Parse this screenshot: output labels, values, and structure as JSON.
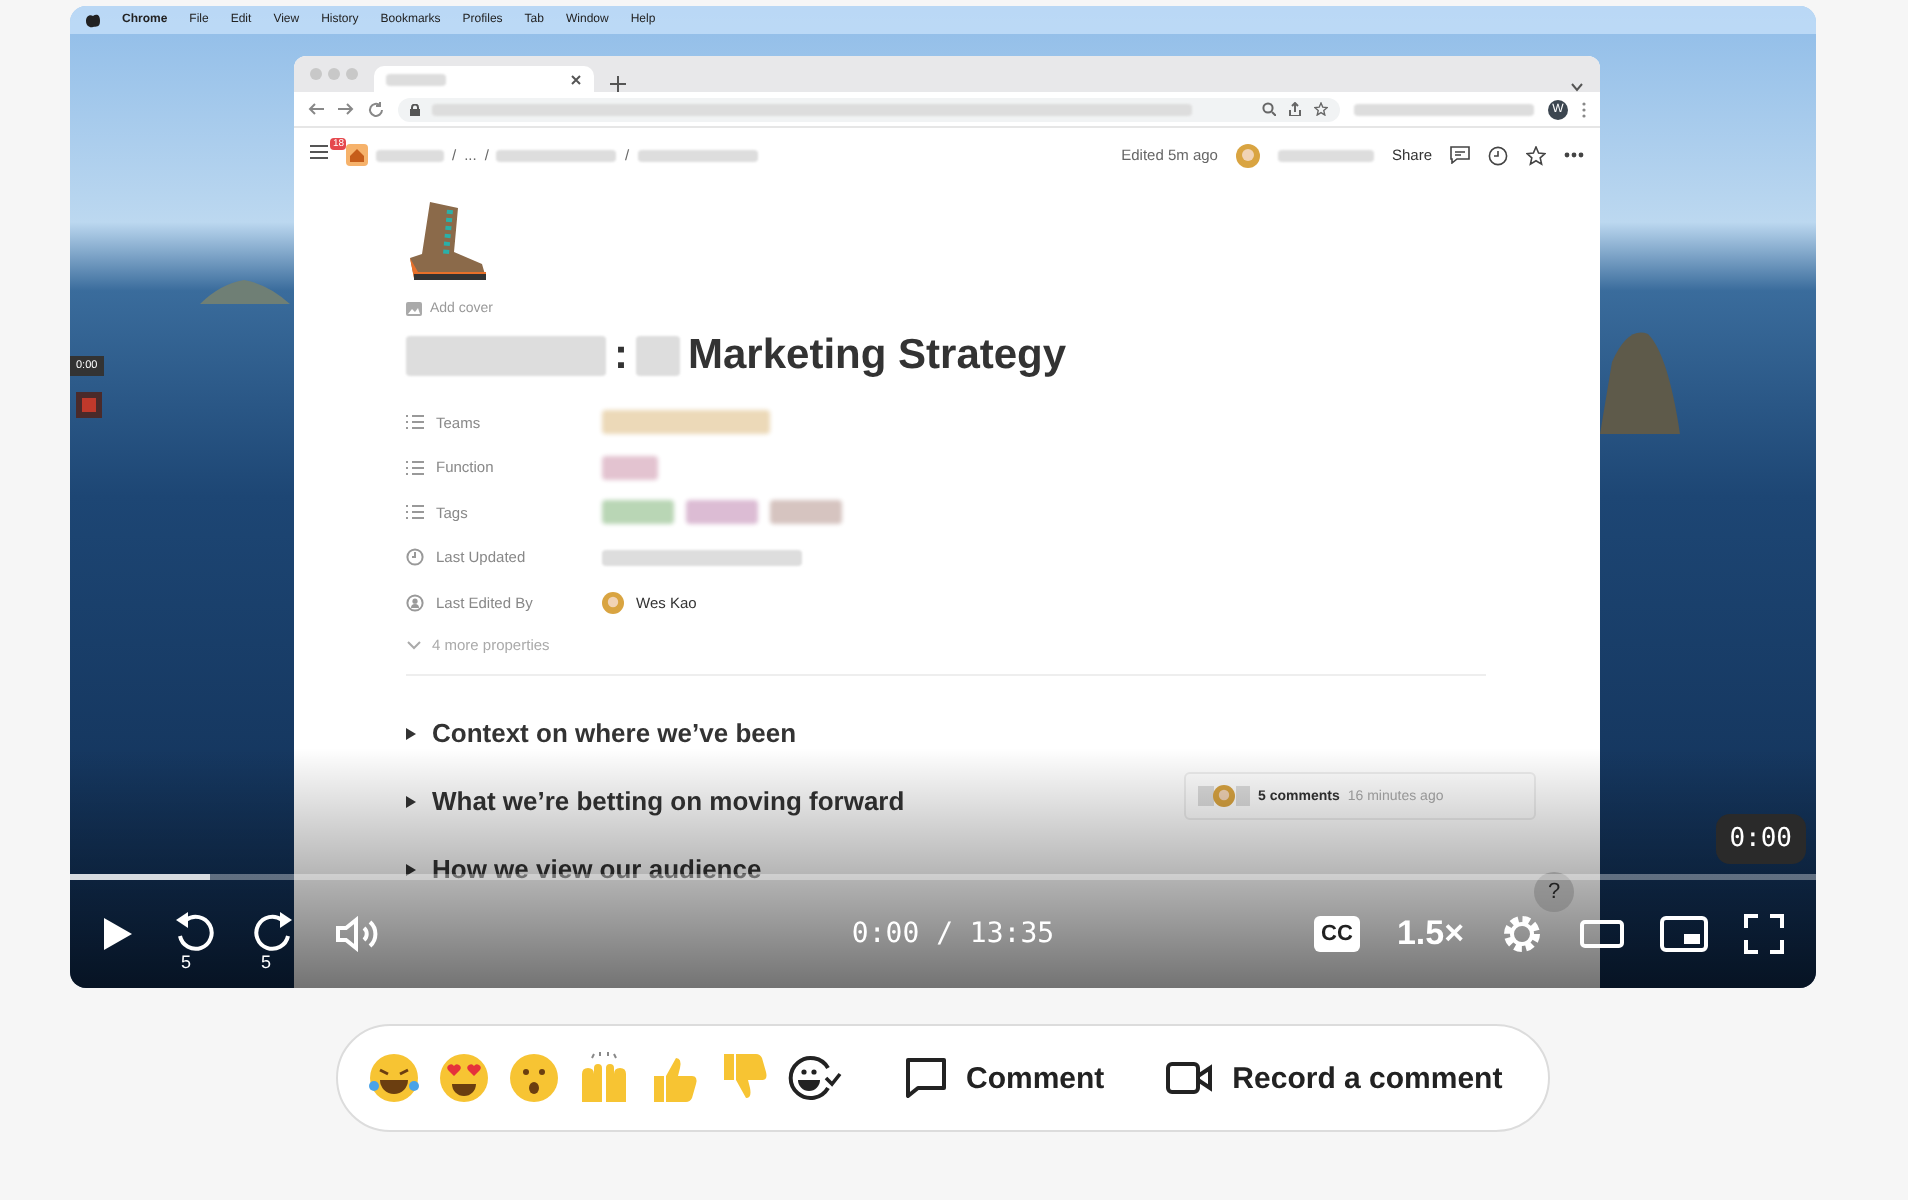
{
  "video": {
    "menu_bar": [
      "Chrome",
      "File",
      "Edit",
      "View",
      "History",
      "Bookmarks",
      "Profiles",
      "Tab",
      "Window",
      "Help"
    ],
    "side_badge": "0:00",
    "browser": {
      "profile_initial": "W"
    },
    "notion_header": {
      "notification_count": "18",
      "breadcrumb": [
        {
          "kind": "hidden"
        },
        {
          "kind": "text",
          "text": "/"
        },
        {
          "kind": "text",
          "text": "..."
        },
        {
          "kind": "text",
          "text": "/"
        },
        {
          "kind": "hidden"
        },
        {
          "kind": "text",
          "text": "/"
        },
        {
          "kind": "hidden"
        }
      ],
      "edited": "Edited 5m ago",
      "share": "Share"
    },
    "page": {
      "add_cover": "Add cover",
      "title": [
        {
          "kind": "hidden"
        },
        {
          "kind": "text",
          "text": ":"
        },
        {
          "kind": "hidden"
        },
        {
          "kind": "text",
          "text": "Marketing Strategy"
        }
      ],
      "properties": [
        {
          "kind": "tags",
          "label": "Teams",
          "tags": [
            {
              "color": "#ecd9b8"
            }
          ]
        },
        {
          "kind": "tags",
          "label": "Function",
          "tags": [
            {
              "color": "#e3c3d0"
            }
          ]
        },
        {
          "kind": "tags",
          "label": "Tags",
          "tags": [
            {
              "color": "#b9d6b5"
            },
            {
              "color": "#dcbcd4"
            },
            {
              "color": "#d6c4c0"
            }
          ]
        },
        {
          "kind": "date",
          "label": "Last Updated"
        },
        {
          "kind": "person",
          "label": "Last Edited By",
          "person": "Wes Kao"
        }
      ],
      "more_properties": "4 more properties",
      "toggles": [
        "Context on where we’ve been",
        "What we’re betting on moving forward",
        "How we view our audience"
      ],
      "comment": {
        "count": "5 comments",
        "time": "16 minutes ago"
      }
    },
    "player": {
      "scrubber": {
        "level": 0.08
      },
      "tooltip": "0:00",
      "help": "?",
      "skip_back": "5",
      "skip_forward": "5",
      "time": "0:00 / 13:35",
      "cc": "CC",
      "speed": "1.5×"
    }
  },
  "reactions": {
    "comment": "Comment",
    "record": "Record a comment"
  }
}
